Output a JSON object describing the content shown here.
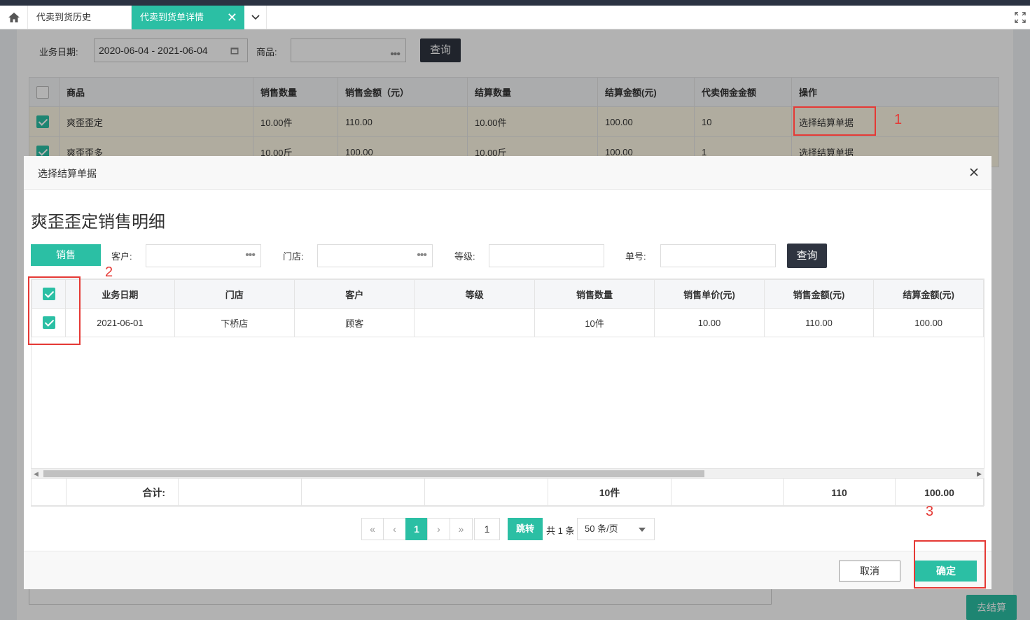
{
  "tabs": {
    "items": [
      {
        "label": "代卖到货历史"
      },
      {
        "label": "代卖到货单详情"
      }
    ]
  },
  "background": {
    "filters": {
      "date_label": "业务日期:",
      "date_value": "2020-06-04 - 2021-06-04",
      "product_label": "商品:",
      "query_label": "查询"
    },
    "table": {
      "columns": [
        "商品",
        "销售数量",
        "销售金额（元）",
        "结算数量",
        "结算金额(元)",
        "代卖佣金金额",
        "操作"
      ],
      "rows": [
        {
          "product": "爽歪歪定",
          "sale_qty": "10.00件",
          "sale_amount": "110.00",
          "settle_qty": "10.00件",
          "settle_amount": "100.00",
          "commission": "10",
          "action": "选择结算单据"
        },
        {
          "product": "爽歪歪多",
          "sale_qty": "10.00斤",
          "sale_amount": "100.00",
          "settle_qty": "10.00斤",
          "settle_amount": "100.00",
          "commission": "1",
          "action": "选择结算单据"
        }
      ]
    },
    "go_settle_label": "去结算"
  },
  "modal": {
    "title": "选择结算单据",
    "heading": "爽歪歪定销售明细",
    "filter_tab": "销售",
    "filters": {
      "customer_label": "客户:",
      "store_label": "门店:",
      "grade_label": "等级:",
      "order_no_label": "单号:",
      "query_label": "查询"
    },
    "grid": {
      "columns": [
        "业务日期",
        "门店",
        "客户",
        "等级",
        "销售数量",
        "销售单价(元)",
        "销售金额(元)",
        "结算金额(元)"
      ],
      "rows": [
        {
          "date": "2021-06-01",
          "store": "下桥店",
          "customer": "顾客",
          "grade": "",
          "qty": "10件",
          "unit_price": "10.00",
          "amount": "110.00",
          "settle": "100.00"
        }
      ],
      "summary": {
        "label": "合计:",
        "qty": "10件",
        "amount": "110",
        "settle": "100.00"
      }
    },
    "pagination": {
      "first": "«",
      "prev": "‹",
      "current": "1",
      "next": "›",
      "last": "»",
      "jump_value": "1",
      "jump_label": "跳转",
      "total_text": "共 1 条",
      "page_size": "50 条/页"
    },
    "cancel_label": "取消",
    "ok_label": "确定"
  },
  "annotations": [
    "1",
    "2",
    "3"
  ],
  "colors": {
    "accent": "#2bbfa4",
    "dark_button": "#2e3440",
    "annotation": "#e53935"
  }
}
